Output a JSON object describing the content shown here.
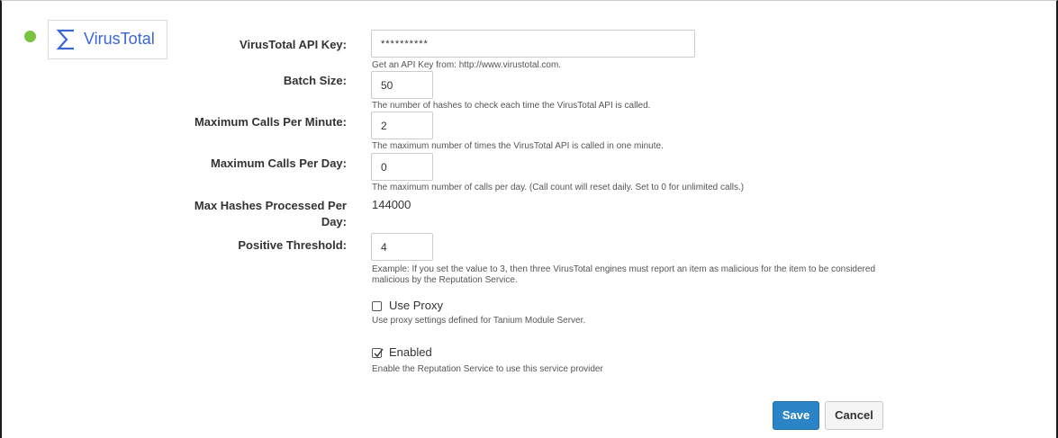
{
  "provider": {
    "name": "VirusTotal",
    "logo_icon": "sigma-icon",
    "status_color": "#7cc242",
    "brand_color": "#3a66d6"
  },
  "form": {
    "api_key": {
      "label": "VirusTotal API Key:",
      "value": "**********",
      "help": "Get an API Key from: http://www.virustotal.com."
    },
    "batch_size": {
      "label": "Batch Size:",
      "value": "50",
      "help": "The number of hashes to check each time the VirusTotal API is called."
    },
    "max_calls_per_minute": {
      "label": "Maximum Calls Per Minute:",
      "value": "2",
      "help": "The maximum number of times the VirusTotal API is called in one minute."
    },
    "max_calls_per_day": {
      "label": "Maximum Calls Per Day:",
      "value": "0",
      "help": "The maximum number of calls per day. (Call count will reset daily. Set to 0 for unlimited calls.)"
    },
    "max_hashes_per_day": {
      "label": "Max Hashes Processed Per Day:",
      "value": "144000"
    },
    "positive_threshold": {
      "label": "Positive Threshold:",
      "value": "4",
      "help": "Example: If you set the value to 3, then three VirusTotal engines must report an item as malicious for the item to be considered malicious by the Reputation Service."
    },
    "use_proxy": {
      "label": "Use Proxy",
      "checked": false,
      "help": "Use proxy settings defined for Tanium Module Server."
    },
    "enabled": {
      "label": "Enabled",
      "checked": true,
      "help": "Enable the Reputation Service to use this service provider"
    }
  },
  "actions": {
    "save_label": "Save",
    "cancel_label": "Cancel",
    "save_color": "#2a84c6"
  }
}
